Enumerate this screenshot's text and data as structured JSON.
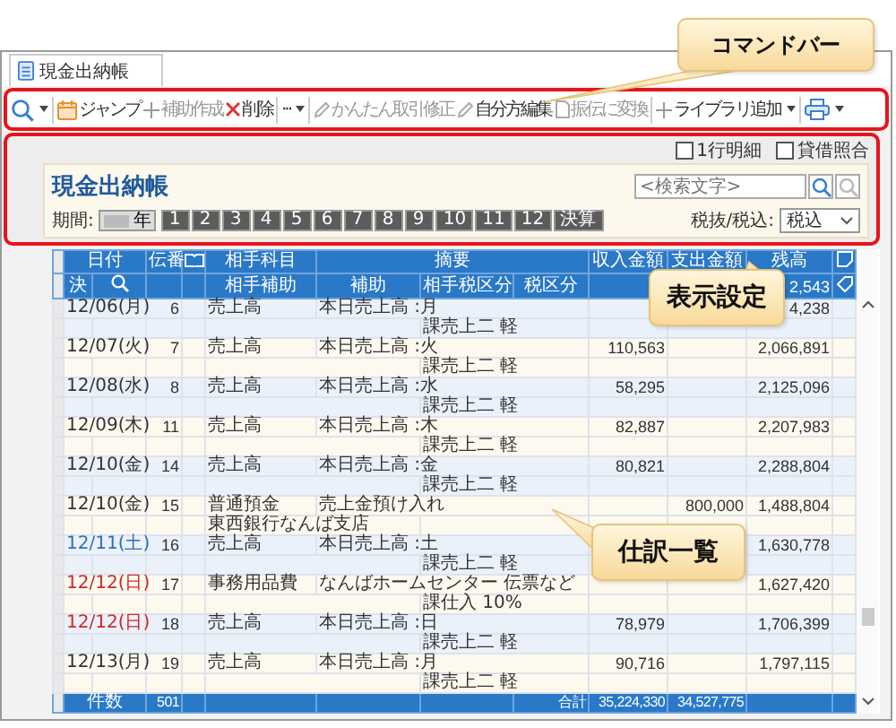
{
  "window": {
    "tab": "現金出納帳"
  },
  "toolbar": [
    {
      "kind": "search-menu"
    },
    {
      "kind": "button",
      "label": "ジャンプ",
      "disabled": false
    },
    {
      "kind": "button",
      "label": "補助作成",
      "disabled": true
    },
    {
      "kind": "button",
      "label": "削除",
      "disabled": false
    },
    {
      "kind": "menu",
      "label": "···",
      "disabled": false
    },
    {
      "kind": "button",
      "label": "かんたん取引修正",
      "disabled": true
    },
    {
      "kind": "button",
      "label": "自分方編集",
      "disabled": false
    },
    {
      "kind": "button",
      "label": "振伝に変換",
      "disabled": true
    },
    {
      "kind": "menu",
      "label": "ライブラリ追加",
      "disabled": false
    },
    {
      "kind": "print-menu"
    }
  ],
  "options": [
    {
      "label": "1行明細",
      "checked": false
    },
    {
      "label": "貸借照合",
      "checked": false
    }
  ],
  "panel": {
    "title": "現金出納帳",
    "search": {
      "placeholder": "<検索文字>"
    },
    "period_label": "期間:",
    "year_toggle": "年",
    "months": [
      {
        "label": "1",
        "selected": true
      },
      {
        "label": "2",
        "selected": true
      },
      {
        "label": "3",
        "selected": true
      },
      {
        "label": "4",
        "selected": true
      },
      {
        "label": "5",
        "selected": true
      },
      {
        "label": "6",
        "selected": true
      },
      {
        "label": "7",
        "selected": true
      },
      {
        "label": "8",
        "selected": true
      },
      {
        "label": "9",
        "selected": true
      },
      {
        "label": "10",
        "selected": true
      },
      {
        "label": "11",
        "selected": true
      },
      {
        "label": "12",
        "selected": true
      },
      {
        "label": "決算",
        "selected": true
      }
    ],
    "tax_label": "税抜/税込:",
    "tax_value": "税込"
  },
  "table": {
    "header": {
      "date": "日付",
      "voucher": "伝番",
      "account": "相手科目",
      "summary": "摘要",
      "income": "収入金額",
      "expense": "支出金額",
      "balance": "残高",
      "settled": "決",
      "account_sub": "相手補助",
      "sub": "補助",
      "partner_tax": "相手税区分",
      "tax": "税区分",
      "balance_carry": "2,543"
    },
    "rows": [
      {
        "date": "12/06(月)",
        "color": "#333333",
        "no": "6",
        "account": "売上高",
        "summary": "本日売上高 :月",
        "tax": "課売上二 軽",
        "balance": "4,238"
      },
      {
        "date": "12/07(火)",
        "color": "#333333",
        "no": "7",
        "account": "売上高",
        "summary": "本日売上高 :火",
        "tax": "課売上二 軽",
        "income": "110,563",
        "balance": "2,066,891"
      },
      {
        "date": "12/08(水)",
        "color": "#333333",
        "no": "8",
        "account": "売上高",
        "summary": "本日売上高 :水",
        "tax": "課売上二 軽",
        "income": "58,295",
        "balance": "2,125,096"
      },
      {
        "date": "12/09(木)",
        "color": "#333333",
        "no": "11",
        "account": "売上高",
        "summary": "本日売上高 :木",
        "tax": "課売上二 軽",
        "income": "82,887",
        "balance": "2,207,983"
      },
      {
        "date": "12/10(金)",
        "color": "#333333",
        "no": "14",
        "account": "売上高",
        "summary": "本日売上高 :金",
        "tax": "課売上二 軽",
        "income": "80,821",
        "balance": "2,288,804"
      },
      {
        "date": "12/10(金)",
        "color": "#333333",
        "no": "15",
        "account": "普通預金",
        "account_sub": "東西銀行なんば支店",
        "summary": "売上金預け入れ",
        "expense": "800,000",
        "balance": "1,488,804"
      },
      {
        "date": "12/11(土)",
        "color": "#2f6fb5",
        "no": "16",
        "account": "売上高",
        "summary": "本日売上高 :土",
        "tax": "課売上二 軽",
        "balance": "1,630,778"
      },
      {
        "date": "12/12(日)",
        "color": "#cc2a2a",
        "no": "17",
        "account": "事務用品費",
        "summary": "なんばホームセンター 伝票など",
        "tax": "課仕入 10%",
        "balance": "1,627,420"
      },
      {
        "date": "12/12(日)",
        "color": "#cc2a2a",
        "no": "18",
        "account": "売上高",
        "summary": "本日売上高 :日",
        "tax": "課売上二 軽",
        "income": "78,979",
        "balance": "1,706,399"
      },
      {
        "date": "12/13(月)",
        "color": "#333333",
        "no": "19",
        "account": "売上高",
        "summary": "本日売上高 :月",
        "tax": "課売上二 軽",
        "income": "90,716",
        "balance": "1,797,115"
      }
    ],
    "footer": {
      "count_label": "件数",
      "count": "501",
      "total_label": "合計",
      "income_total": "35,224,330",
      "expense_total": "34,527,775"
    }
  },
  "callouts": [
    {
      "label": "コマンドバー"
    },
    {
      "label": "表示設定"
    },
    {
      "label": "仕訳一覧"
    }
  ]
}
